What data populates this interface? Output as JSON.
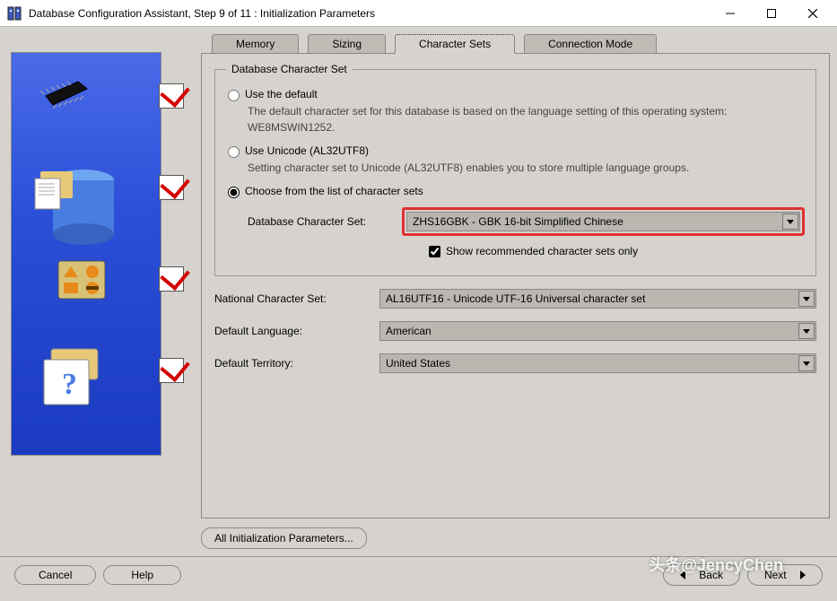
{
  "window": {
    "title": "Database Configuration Assistant, Step 9 of 11 : Initialization Parameters"
  },
  "tabs": {
    "memory": "Memory",
    "sizing": "Sizing",
    "character_sets": "Character Sets",
    "connection_mode": "Connection Mode"
  },
  "fieldset": {
    "legend": "Database Character Set"
  },
  "options": {
    "use_default": {
      "label": "Use the default",
      "desc": "The default character set for this database is based on the language setting of this operating system: WE8MSWIN1252."
    },
    "use_unicode": {
      "label": "Use Unicode (AL32UTF8)",
      "desc": "Setting character set to Unicode (AL32UTF8) enables you to store multiple language groups."
    },
    "choose_list": {
      "label": "Choose from the list of character sets",
      "field_label": "Database Character Set:",
      "value": "ZHS16GBK - GBK 16-bit Simplified Chinese",
      "show_recommended": "Show recommended character sets only"
    }
  },
  "fields": {
    "national_charset": {
      "label": "National Character Set:",
      "value": "AL16UTF16 - Unicode UTF-16 Universal character set"
    },
    "default_language": {
      "label": "Default Language:",
      "value": "American"
    },
    "default_territory": {
      "label": "Default Territory:",
      "value": "United States"
    }
  },
  "buttons": {
    "all_init_params": "All Initialization Parameters...",
    "cancel": "Cancel",
    "help": "Help",
    "back": "Back",
    "next": "Next"
  },
  "watermark": "头条@JencyChen"
}
